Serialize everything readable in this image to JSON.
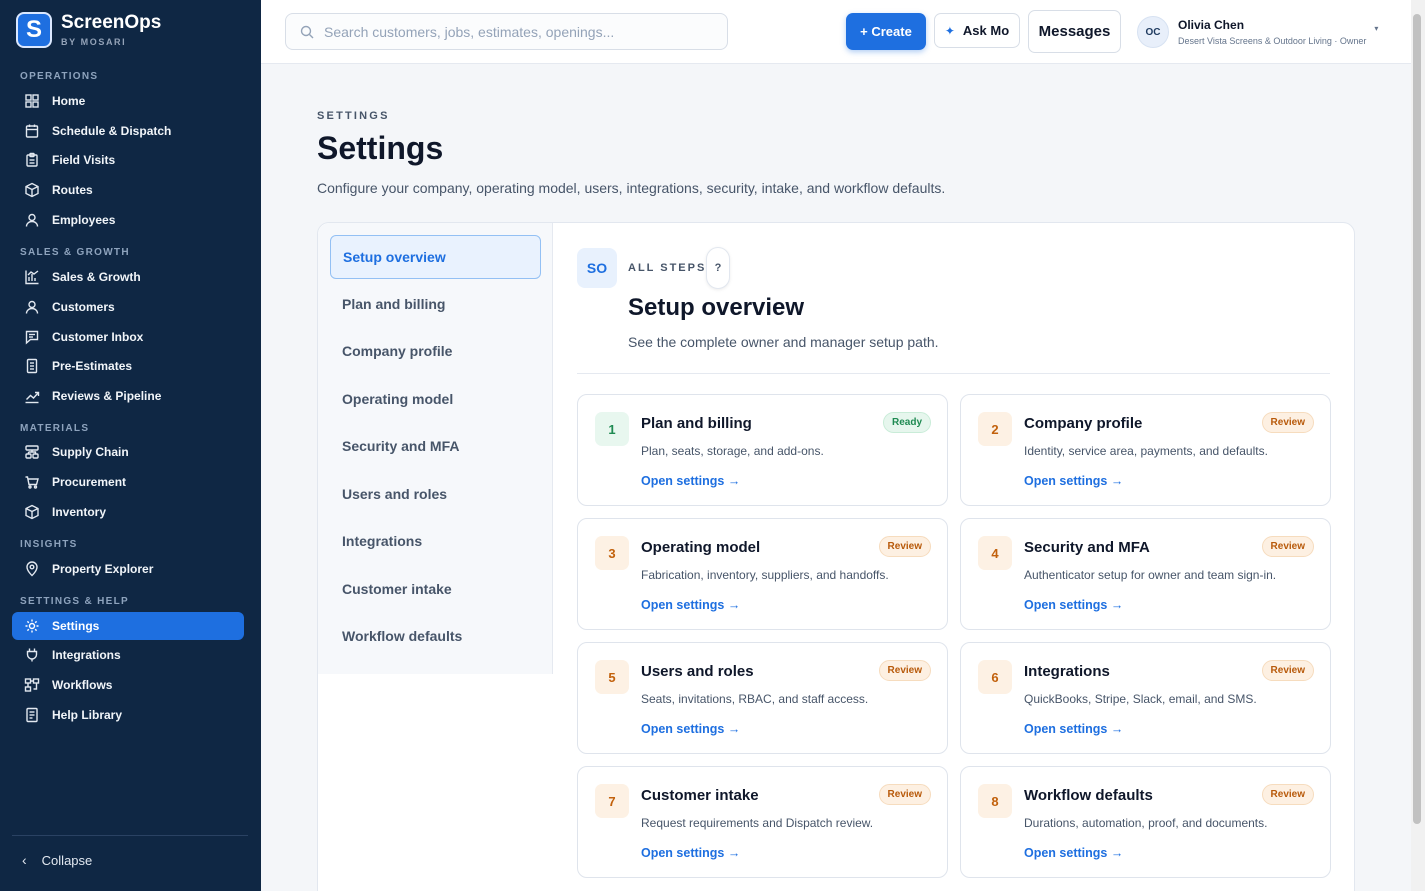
{
  "brand": {
    "name": "ScreenOps",
    "sub": "BY MOSARI",
    "logo_letter": "S"
  },
  "sidebar": {
    "sections": [
      {
        "label": "OPERATIONS"
      },
      {
        "label": "SALES & GROWTH"
      },
      {
        "label": "MATERIALS"
      },
      {
        "label": "INSIGHTS"
      },
      {
        "label": "SETTINGS & HELP"
      }
    ],
    "items": [
      {
        "label": "Home",
        "icon": "grid-icon"
      },
      {
        "label": "Schedule & Dispatch",
        "icon": "calendar-icon"
      },
      {
        "label": "Field Visits",
        "icon": "clipboard-icon"
      },
      {
        "label": "Routes",
        "icon": "cube-icon"
      },
      {
        "label": "Employees",
        "icon": "person-icon"
      },
      {
        "label": "Sales & Growth",
        "icon": "bar-chart-icon"
      },
      {
        "label": "Customers",
        "icon": "person-icon"
      },
      {
        "label": "Customer Inbox",
        "icon": "chat-icon"
      },
      {
        "label": "Pre-Estimates",
        "icon": "document-icon"
      },
      {
        "label": "Reviews & Pipeline",
        "icon": "trend-icon"
      },
      {
        "label": "Supply Chain",
        "icon": "layers-icon"
      },
      {
        "label": "Procurement",
        "icon": "cart-icon"
      },
      {
        "label": "Inventory",
        "icon": "cube-icon"
      },
      {
        "label": "Property Explorer",
        "icon": "map-pin-icon"
      },
      {
        "label": "Settings",
        "icon": "gear-icon"
      },
      {
        "label": "Integrations",
        "icon": "plug-icon"
      },
      {
        "label": "Workflows",
        "icon": "workflow-icon"
      },
      {
        "label": "Help Library",
        "icon": "book-icon"
      }
    ],
    "active_item": "Settings",
    "collapse_label": "Collapse"
  },
  "topbar": {
    "search_placeholder": "Search customers, jobs, estimates, openings...",
    "create_label": "+ Create",
    "ask_label": "Ask Mo",
    "messages_label": "Messages",
    "user": {
      "initials": "OC",
      "name": "Olivia Chen",
      "org": "Desert Vista Screens & Outdoor Living · Owner"
    }
  },
  "page": {
    "eyebrow": "SETTINGS",
    "title": "Settings",
    "subtitle": "Configure your company, operating model, users, integrations, security, intake, and workflow defaults."
  },
  "subnav": {
    "items": [
      "Setup overview",
      "Plan and billing",
      "Company profile",
      "Operating model",
      "Security and MFA",
      "Users and roles",
      "Integrations",
      "Customer intake",
      "Workflow defaults"
    ],
    "active": "Setup overview"
  },
  "overview": {
    "badge": "SO",
    "eyebrow": "ALL STEPS",
    "help": "?",
    "title": "Setup overview",
    "subtitle": "See the complete owner and manager setup path.",
    "cards": [
      {
        "num": "1",
        "title": "Plan and billing",
        "desc": "Plan, seats, storage, and add-ons.",
        "status": "Ready",
        "link": "Open settings →"
      },
      {
        "num": "2",
        "title": "Company profile",
        "desc": "Identity, service area, payments, and defaults.",
        "status": "Review",
        "link": "Open settings →"
      },
      {
        "num": "3",
        "title": "Operating model",
        "desc": "Fabrication, inventory, suppliers, and handoffs.",
        "status": "Review",
        "link": "Open settings →"
      },
      {
        "num": "4",
        "title": "Security and MFA",
        "desc": "Authenticator setup for owner and team sign-in.",
        "status": "Review",
        "link": "Open settings →"
      },
      {
        "num": "5",
        "title": "Users and roles",
        "desc": "Seats, invitations, RBAC, and staff access.",
        "status": "Review",
        "link": "Open settings →"
      },
      {
        "num": "6",
        "title": "Integrations",
        "desc": "QuickBooks, Stripe, Slack, email, and SMS.",
        "status": "Review",
        "link": "Open settings →"
      },
      {
        "num": "7",
        "title": "Customer intake",
        "desc": "Request requirements and Dispatch review.",
        "status": "Review",
        "link": "Open settings →"
      },
      {
        "num": "8",
        "title": "Workflow defaults",
        "desc": "Durations, automation, proof, and documents.",
        "status": "Review",
        "link": "Open settings →"
      }
    ]
  }
}
